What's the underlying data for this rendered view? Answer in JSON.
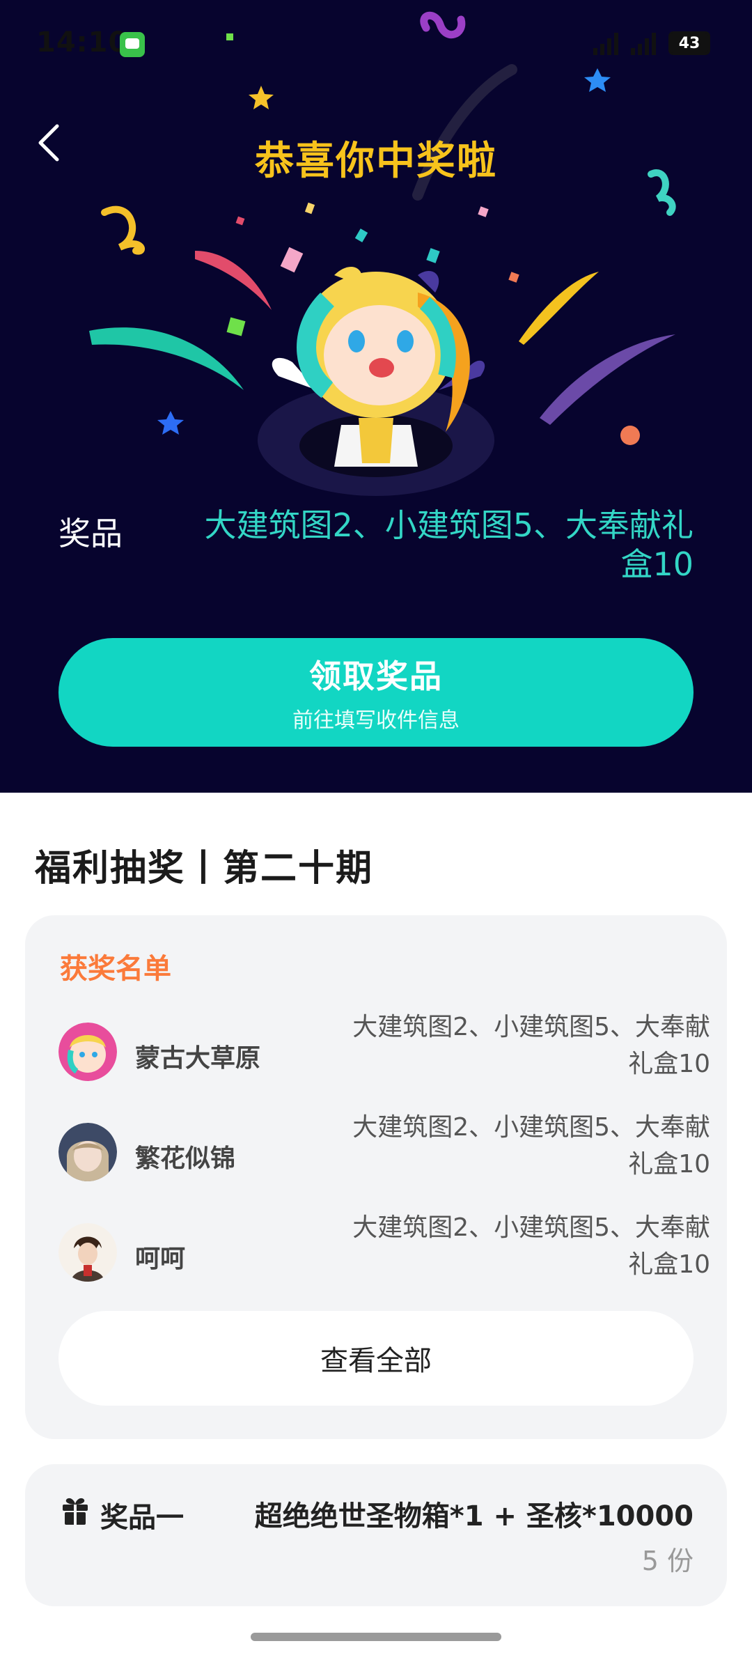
{
  "status_bar": {
    "time": "14:10",
    "battery": "43"
  },
  "header": {
    "title": "恭喜你中奖啦"
  },
  "prize": {
    "label": "奖品",
    "value": "大建筑图2、小建筑图5、大奉献礼盒10"
  },
  "claim": {
    "title": "领取奖品",
    "subtitle": "前往填写收件信息"
  },
  "section_title": "福利抽奖丨第二十期",
  "winners": {
    "heading": "获奖名单",
    "items": [
      {
        "name": "蒙古大草原",
        "prize": "大建筑图2、小建筑图5、大奉献礼盒10"
      },
      {
        "name": "繁花似锦",
        "prize": "大建筑图2、小建筑图5、大奉献礼盒10"
      },
      {
        "name": "呵呵",
        "prize": "大建筑图2、小建筑图5、大奉献礼盒10"
      }
    ],
    "view_all": "查看全部"
  },
  "prize_card": {
    "label": "奖品一",
    "value": "超绝绝世圣物箱*1 + 圣核*10000",
    "count": "5 份"
  },
  "colors": {
    "hero_bg": "#07042e",
    "accent": "#12d6c3",
    "title_gold": "#f7c31c",
    "winners_heading": "#fb7a3a"
  }
}
